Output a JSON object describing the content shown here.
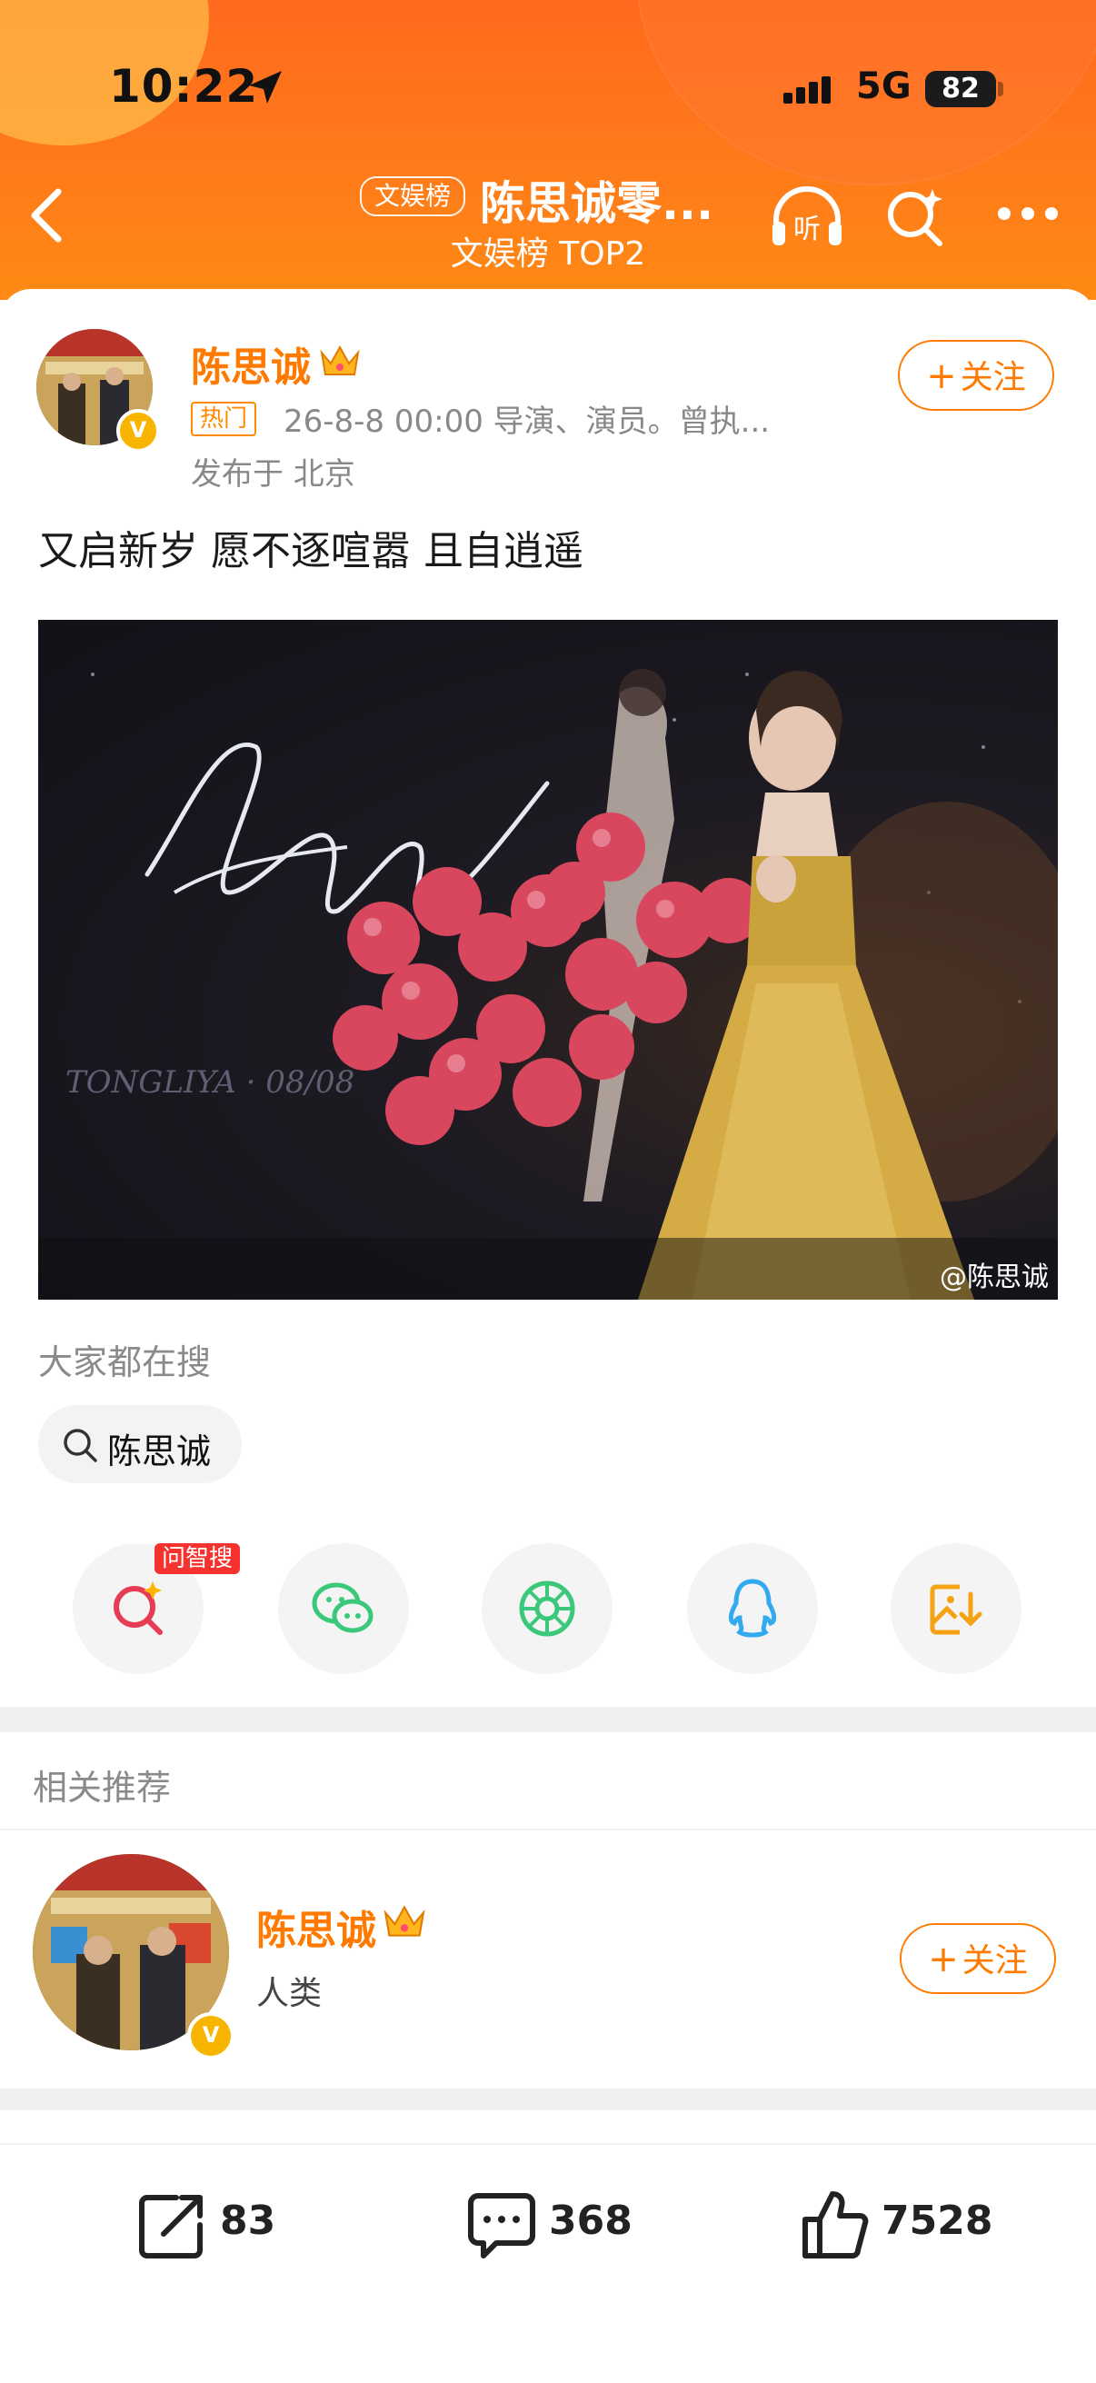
{
  "status_bar": {
    "time": "10:22",
    "network": "5G",
    "battery": "82"
  },
  "nav": {
    "badge": "文娱榜",
    "title": "陈思诚零...",
    "subtitle": "文娱榜 TOP2"
  },
  "post": {
    "author": "陈思诚",
    "hot_tag": "热门",
    "meta": "26-8-8 00:00  导演、演员。曾执...",
    "location": "发布于 北京",
    "follow_label": "关注",
    "text": "又启新岁 愿不逐喧嚣 且自逍遥",
    "image_watermark": "@陈思诚"
  },
  "searching": {
    "label": "大家都在搜",
    "chip": "陈思诚"
  },
  "share": {
    "zhisou_tag": "问智搜"
  },
  "related": {
    "label": "相关推荐",
    "user": {
      "name": "陈思诚",
      "bio": "人类",
      "follow_label": "关注"
    }
  },
  "actions": {
    "share_count": "83",
    "comment_count": "368",
    "like_count": "7528"
  },
  "colors": {
    "accent": "#ff7a00",
    "header": "#ff6a1e",
    "hot": "#ff8a00"
  }
}
